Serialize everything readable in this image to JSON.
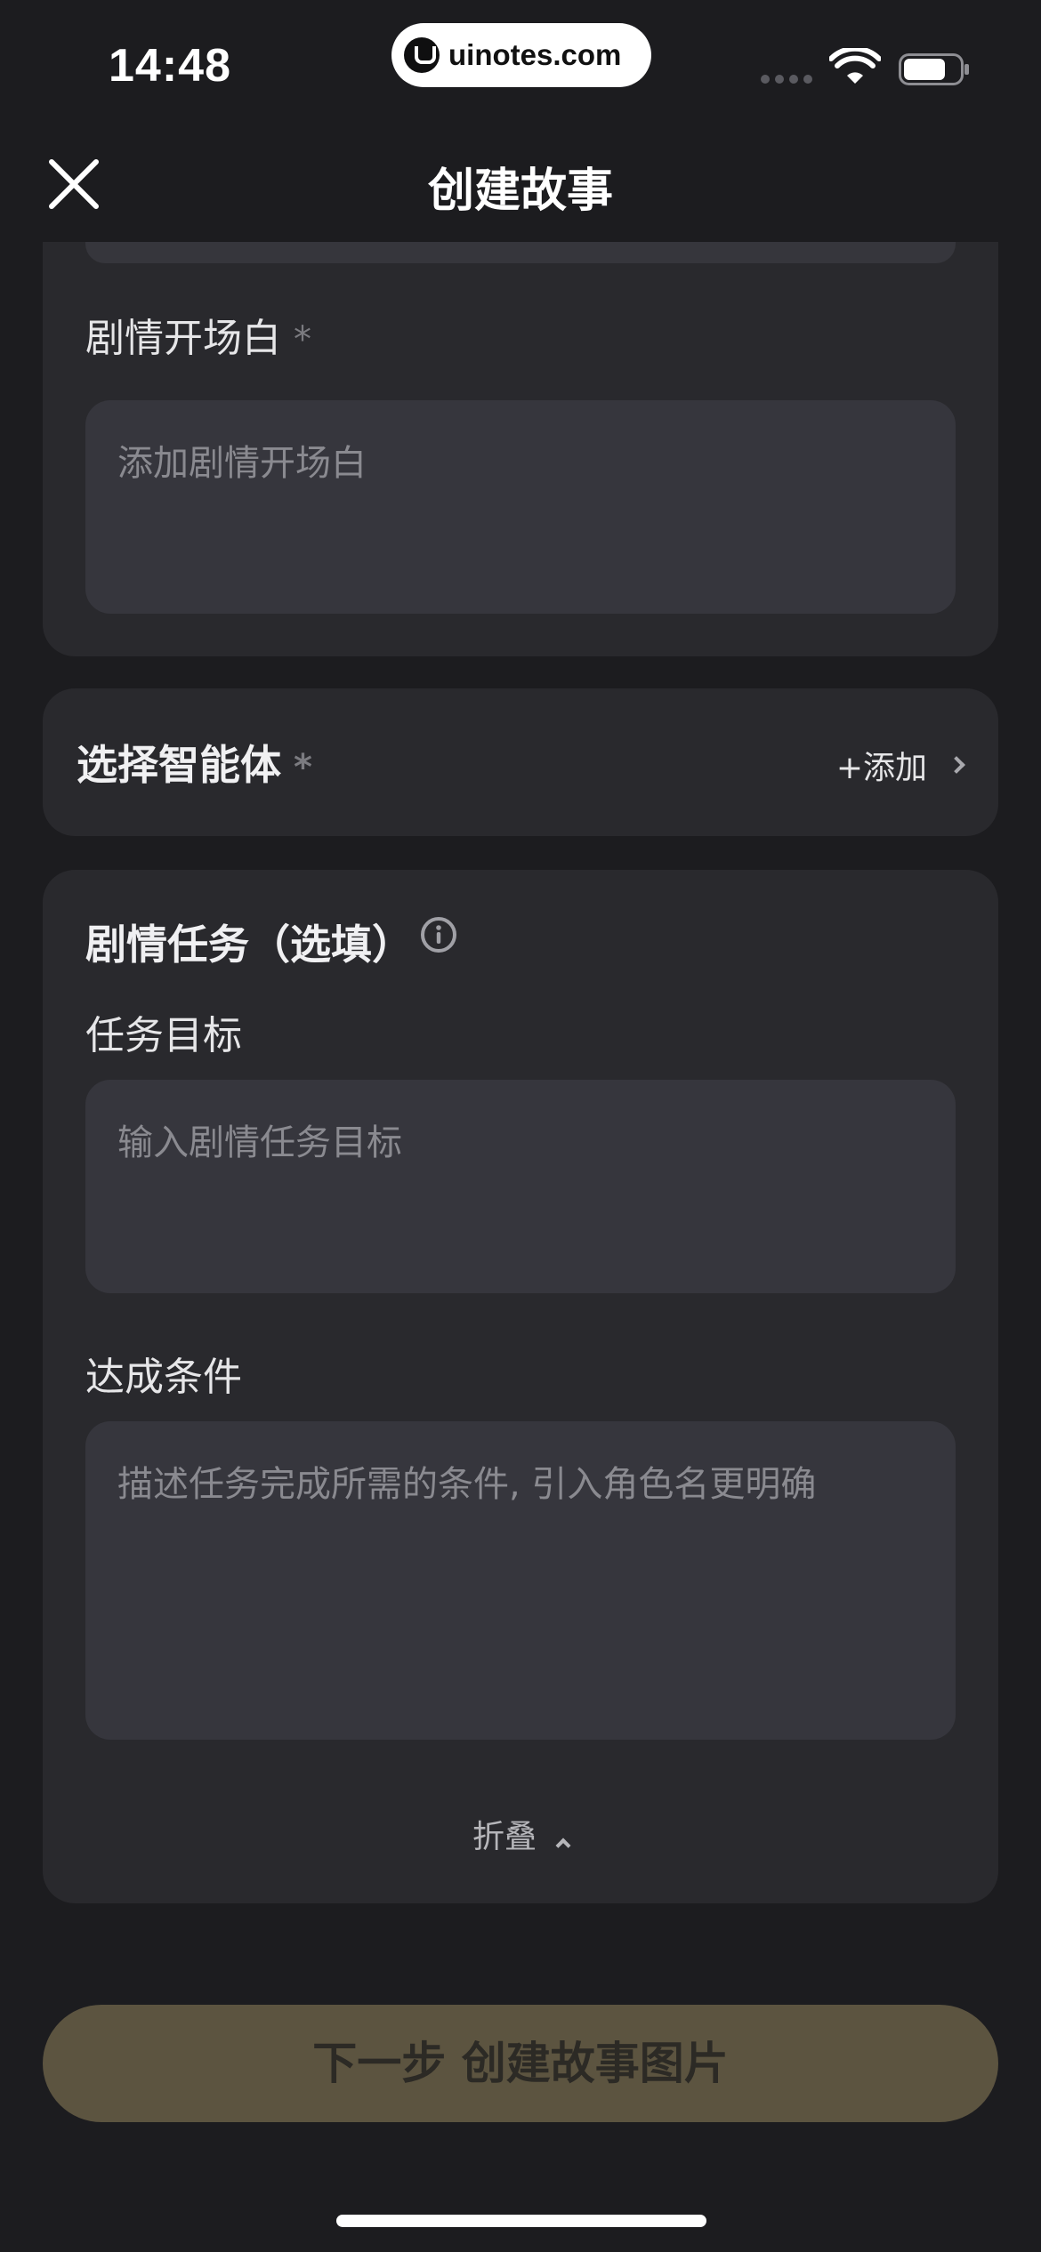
{
  "status_bar": {
    "time": "14:48",
    "watermark": "uinotes.com"
  },
  "nav": {
    "title": "创建故事",
    "close_icon": "close-icon"
  },
  "opening": {
    "label": "剧情开场白",
    "required_mark": "*",
    "placeholder": "添加剧情开场白"
  },
  "agent": {
    "label": "选择智能体",
    "required_mark": "*",
    "add_label": "+添加"
  },
  "task": {
    "title": "剧情任务（选填）",
    "goal_label": "任务目标",
    "goal_placeholder": "输入剧情任务目标",
    "condition_label": "达成条件",
    "condition_placeholder": "描述任务完成所需的条件, 引入角色名更明确",
    "collapse_label": "折叠"
  },
  "footer": {
    "next_label": "下一步 创建故事图片"
  },
  "colors": {
    "background": "#1c1c1f",
    "card": "#29292d",
    "input": "#36363d",
    "next_button": "#5c5440"
  }
}
